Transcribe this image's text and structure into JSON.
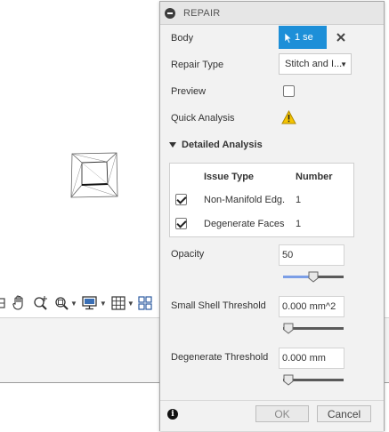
{
  "panel": {
    "title": "REPAIR",
    "body_label": "Body",
    "body_selection": "1 se",
    "repair_type_label": "Repair Type",
    "repair_type_value": "Stitch and I...",
    "preview_label": "Preview",
    "preview_checked": false,
    "quick_analysis_label": "Quick Analysis",
    "quick_analysis_icon": "warning-icon",
    "detailed_analysis_label": "Detailed Analysis",
    "table": {
      "headers": [
        "Issue Type",
        "Number"
      ],
      "rows": [
        {
          "checked": true,
          "issue": "Non-Manifold Edg...",
          "number": "1"
        },
        {
          "checked": true,
          "issue": "Degenerate Faces",
          "number": "1"
        }
      ]
    },
    "opacity_label": "Opacity",
    "opacity_value": "50",
    "opacity_slider_fraction": 0.5,
    "small_shell_label": "Small Shell Threshold",
    "small_shell_value": "0.000 mm^2",
    "small_shell_slider_fraction": 0,
    "degenerate_label": "Degenerate Threshold",
    "degenerate_value": "0.000 mm",
    "degenerate_slider_fraction": 0,
    "ok_label": "OK",
    "cancel_label": "Cancel"
  },
  "toolbar": {
    "icons": [
      "orbit-icon",
      "pan-hand-icon",
      "zoom-window-icon",
      "fit-zoom-icon",
      "display-settings-icon",
      "grid-icon",
      "viewports-icon"
    ]
  },
  "colors": {
    "selection_blue": "#1d8fd8",
    "slider_fill": "#7b9ee6",
    "warning_yellow": "#f5c400"
  }
}
